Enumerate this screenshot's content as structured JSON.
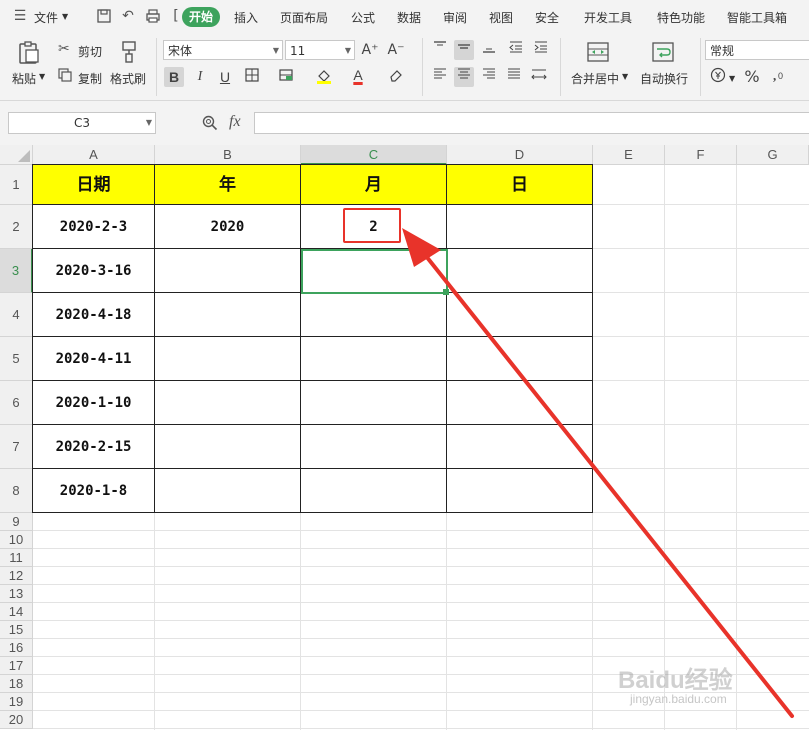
{
  "menubar": {
    "file_label": "文件",
    "tabs": [
      "开始",
      "插入",
      "页面布局",
      "公式",
      "数据",
      "审阅",
      "视图",
      "安全",
      "开发工具",
      "特色功能",
      "智能工具箱"
    ]
  },
  "ribbon": {
    "paste_label": "粘贴",
    "cut_label": "剪切",
    "copy_label": "复制",
    "format_painter_label": "格式刷",
    "font_name": "宋体",
    "font_size": "11",
    "merge_label": "合并居中",
    "wrap_label": "自动换行",
    "number_format": "常规",
    "bold": "B",
    "italic": "I",
    "underline": "U",
    "font_color_letter": "A",
    "grow_font": "A⁺",
    "shrink_font": "A⁻"
  },
  "formula_bar": {
    "name_box": "C3",
    "fx_label": "fx",
    "formula": ""
  },
  "sheet": {
    "columns": [
      "A",
      "B",
      "C",
      "D",
      "E",
      "F",
      "G"
    ],
    "rows": [
      "1",
      "2",
      "3",
      "4",
      "5",
      "6",
      "7",
      "8",
      "9",
      "10",
      "11",
      "12",
      "13",
      "14",
      "15",
      "16",
      "17",
      "18",
      "19",
      "20"
    ],
    "header": [
      "日期",
      "年",
      "月",
      "日"
    ],
    "data": [
      [
        "2020-2-3",
        "2020",
        "2",
        ""
      ],
      [
        "2020-3-16",
        "",
        "",
        ""
      ],
      [
        "2020-4-18",
        "",
        "",
        ""
      ],
      [
        "2020-4-11",
        "",
        "",
        ""
      ],
      [
        "2020-1-10",
        "",
        "",
        ""
      ],
      [
        "2020-2-15",
        "",
        "",
        ""
      ],
      [
        "2020-1-8",
        "",
        "",
        ""
      ]
    ]
  },
  "watermark": {
    "brand": "Baidu经验",
    "url": "jingyan.baidu.com"
  },
  "colors": {
    "header_fill": "#ffff00",
    "accent_green": "#3da35d",
    "annotation_red": "#e8332a"
  }
}
